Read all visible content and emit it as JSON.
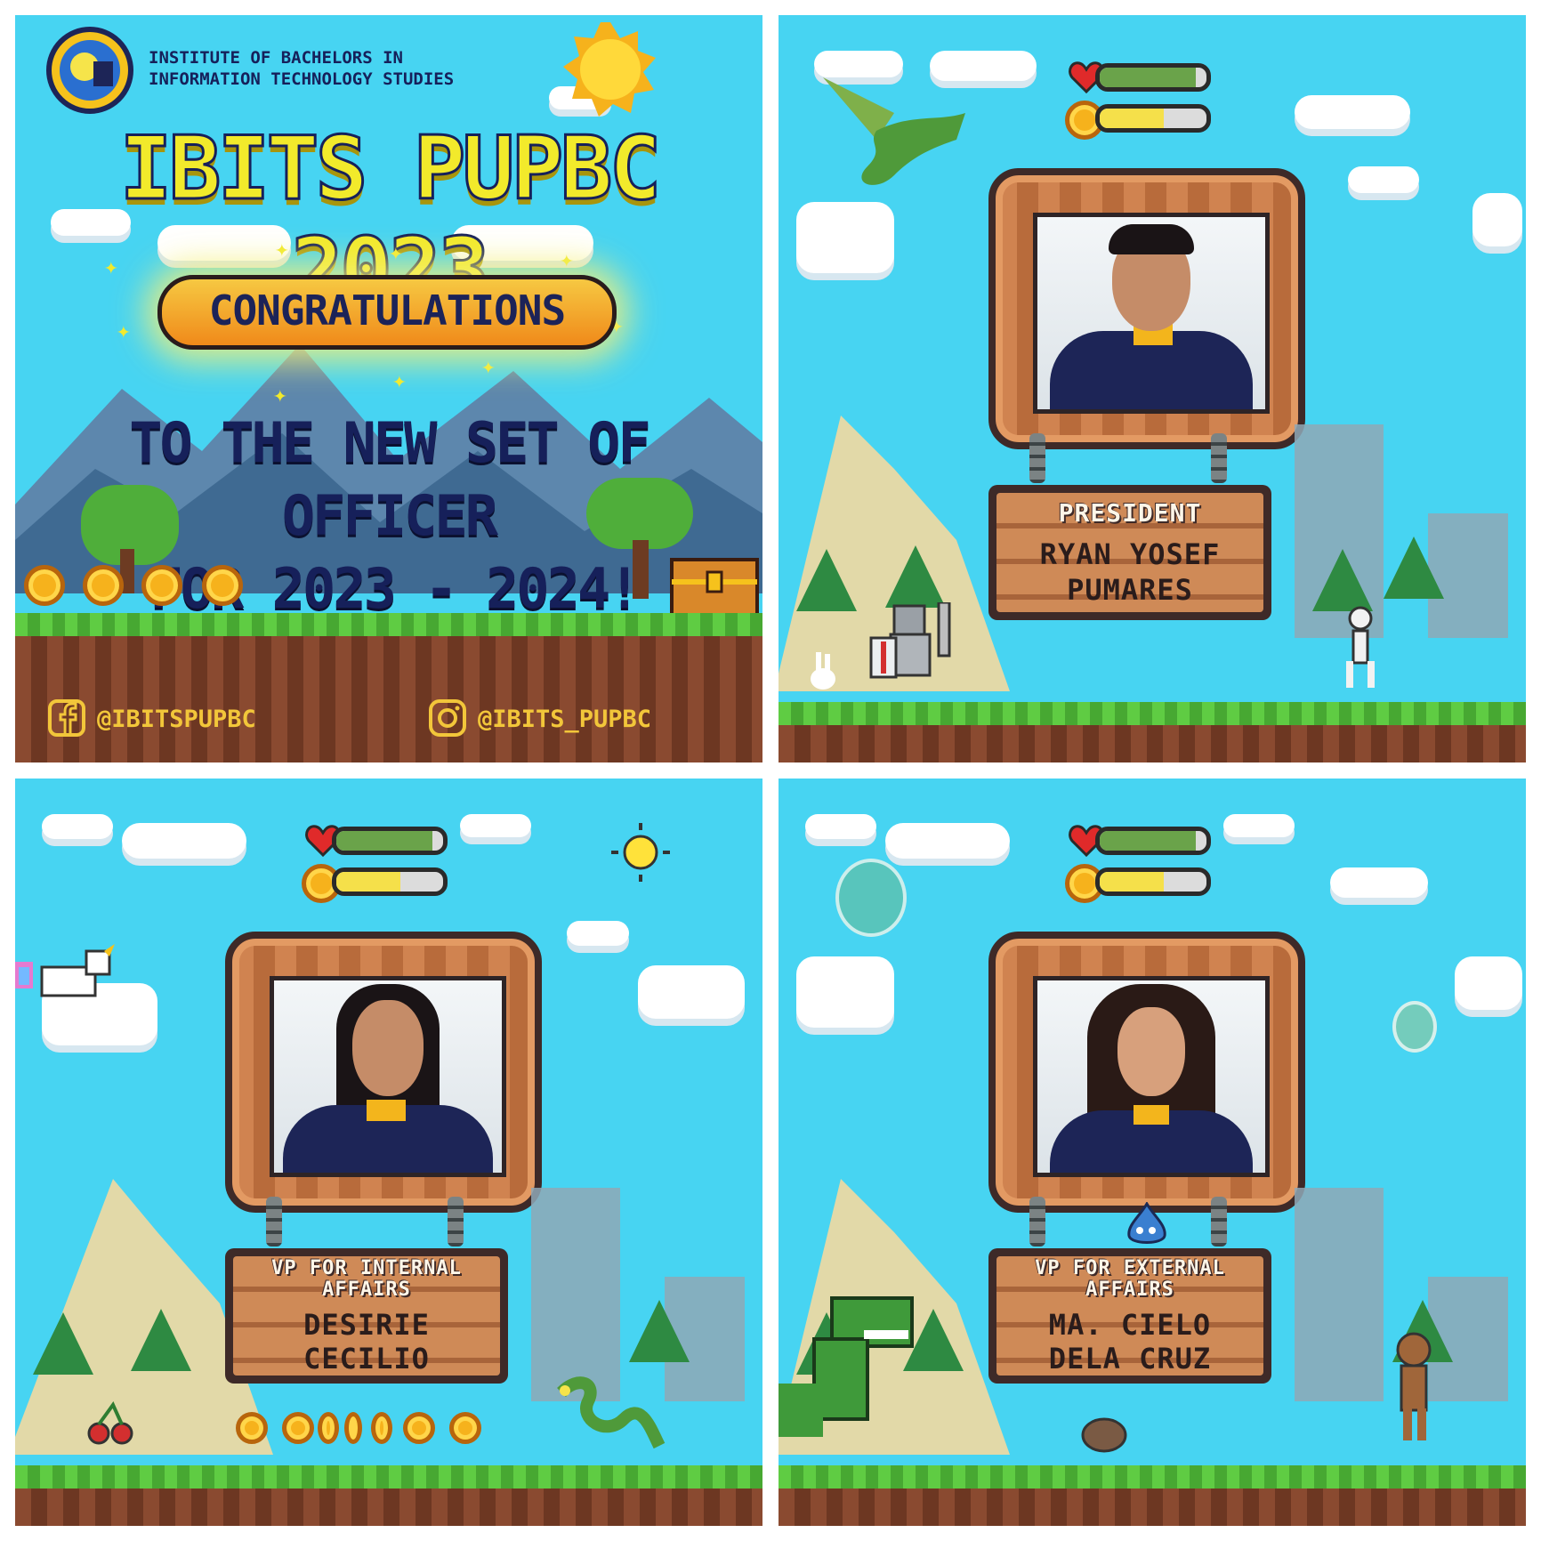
{
  "poster": {
    "org_line1": "INSTITUTE OF BACHELORS IN",
    "org_line2": "INFORMATION TECHNOLOGY STUDIES",
    "headline": "IBITS PUPBC 2023",
    "congrats": "CONGRATULATIONS",
    "message_line1": "TO THE NEW SET OF OFFICER",
    "message_line2": "FOR 2023 - 2024!",
    "facebook_handle": "@IBITSPUPBC",
    "instagram_handle": "@IBITS_PUPBC"
  },
  "officers": [
    {
      "position_lines": [
        "PRESIDENT"
      ],
      "name_lines": [
        "RYAN YOSEF",
        "PUMARES"
      ],
      "health": 0.9,
      "energy": 0.6
    },
    {
      "position_lines": [
        "VP FOR INTERNAL",
        "AFFAIRS"
      ],
      "name_lines": [
        "DESIRIE",
        "CECILIO"
      ],
      "health": 0.9,
      "energy": 0.6
    },
    {
      "position_lines": [
        "VP FOR EXTERNAL",
        "AFFAIRS"
      ],
      "name_lines": [
        "MA. CIELO",
        "DELA CRUZ"
      ],
      "health": 0.9,
      "energy": 0.6
    }
  ],
  "colors": {
    "sky": "#47d4f2",
    "title_yellow": "#f2ea2b",
    "navy_text": "#16205a",
    "grass": "#4fb83a",
    "dirt": "#7a3f28",
    "health_green": "#6aa34a",
    "energy_yellow": "#f5e04a",
    "wood": "#cf8a57"
  },
  "icons": [
    "logo-emblem",
    "sun-icon",
    "facebook-icon",
    "instagram-icon",
    "heart-icon",
    "coin-icon",
    "treasure-chest-icon",
    "dragon-icon",
    "knight-icon",
    "skeleton-icon",
    "unicorn-icon",
    "snake-icon",
    "dinosaur-icon",
    "monkey-icon",
    "slime-icon",
    "cherry-icon"
  ]
}
